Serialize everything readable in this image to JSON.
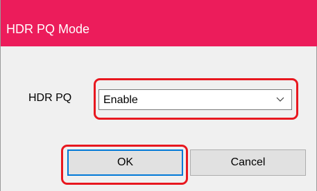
{
  "window": {
    "title": "HDR PQ Mode"
  },
  "form": {
    "hdr_pq_label": "HDR PQ",
    "hdr_pq_value": "Enable"
  },
  "buttons": {
    "ok_label": "OK",
    "cancel_label": "Cancel"
  },
  "colors": {
    "titlebar": "#ec1c5b",
    "highlight": "#e8171f",
    "focus_border": "#0078d7"
  },
  "icons": {
    "dropdown": "chevron-down-icon"
  }
}
